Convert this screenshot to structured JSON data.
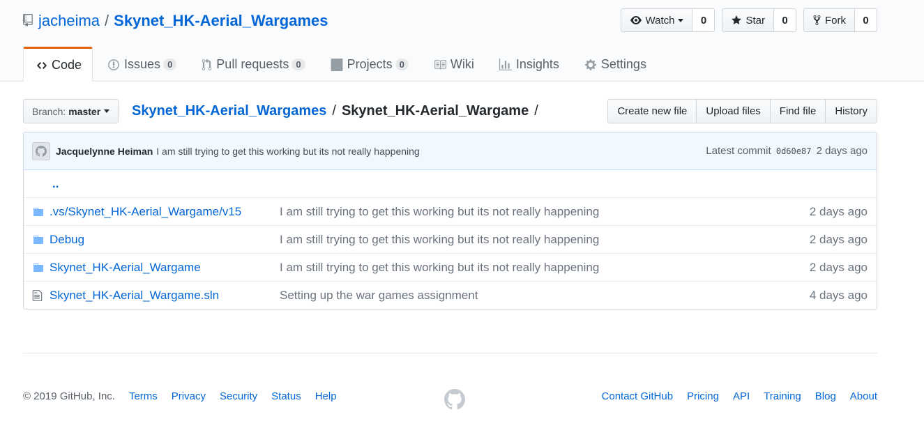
{
  "header": {
    "owner": "jacheima",
    "separator": "/",
    "repo_name": "Skynet_HK-Aerial_Wargames",
    "actions": {
      "watch_label": "Watch",
      "watch_count": "0",
      "star_label": "Star",
      "star_count": "0",
      "fork_label": "Fork",
      "fork_count": "0"
    }
  },
  "tabs": [
    {
      "label": "Code",
      "icon": "code-icon",
      "selected": true
    },
    {
      "label": "Issues",
      "icon": "issue-opened-icon",
      "count": "0"
    },
    {
      "label": "Pull requests",
      "icon": "git-pull-request-icon",
      "count": "0"
    },
    {
      "label": "Projects",
      "icon": "project-icon",
      "count": "0"
    },
    {
      "label": "Wiki",
      "icon": "book-icon"
    },
    {
      "label": "Insights",
      "icon": "graph-icon"
    },
    {
      "label": "Settings",
      "icon": "gear-icon"
    }
  ],
  "file_nav": {
    "branch_label": "Branch:",
    "branch_value": "master",
    "breadcrumb_root": "Skynet_HK-Aerial_Wargames",
    "breadcrumb_sep": "/",
    "breadcrumb_current": "Skynet_HK-Aerial_Wargame",
    "breadcrumb_trailing": "/",
    "buttons": {
      "create": "Create new file",
      "upload": "Upload files",
      "find": "Find file",
      "history": "History"
    }
  },
  "commit": {
    "author": "Jacquelynne Heiman",
    "message": "I am still trying to get this working but its not really happening",
    "latest_label": "Latest commit",
    "sha": "0d60e87",
    "age": "2 days ago"
  },
  "files": {
    "up_label": "..",
    "rows": [
      {
        "type": "folder",
        "name": ".vs/Skynet_HK-Aerial_Wargame/v15",
        "message": "I am still trying to get this working but its not really happening",
        "age": "2 days ago"
      },
      {
        "type": "folder",
        "name": "Debug",
        "message": "I am still trying to get this working but its not really happening",
        "age": "2 days ago"
      },
      {
        "type": "folder",
        "name": "Skynet_HK-Aerial_Wargame",
        "message": "I am still trying to get this working but its not really happening",
        "age": "2 days ago"
      },
      {
        "type": "file",
        "name": "Skynet_HK-Aerial_Wargame.sln",
        "message": "Setting up the war games assignment",
        "age": "4 days ago"
      }
    ]
  },
  "footer": {
    "copyright": "© 2019 GitHub, Inc.",
    "left_links": [
      "Terms",
      "Privacy",
      "Security",
      "Status",
      "Help"
    ],
    "right_links": [
      "Contact GitHub",
      "Pricing",
      "API",
      "Training",
      "Blog",
      "About"
    ]
  },
  "colors": {
    "link": "#0366d6",
    "tab_accent": "#e36209",
    "commit_bg": "#f1f8ff",
    "folder": "#79b8ff"
  }
}
